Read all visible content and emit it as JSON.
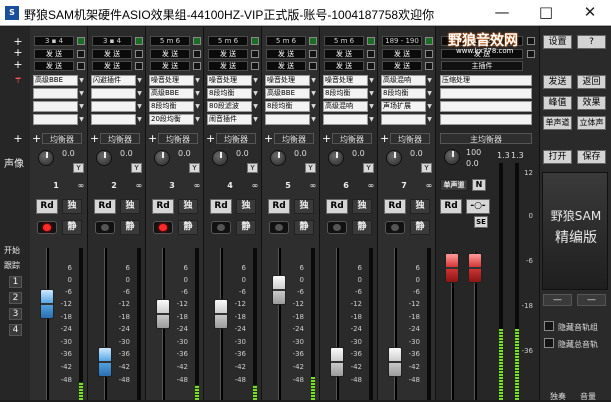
{
  "window": {
    "title": "野狼SAM机架硬件ASIO效果组-44100HZ-VIP正式版-账号-1004187758欢迎你",
    "app_icon": "S",
    "minimize": "—",
    "maximize": "□",
    "close": "✕"
  },
  "left": {
    "sym_plus": "+",
    "sym_pin": "┯",
    "sym_plus2": "+",
    "voice_label": "声像",
    "start_label": "开始",
    "follow_label": "跟踪",
    "channel_buttons": [
      "1",
      "2",
      "3",
      "4"
    ]
  },
  "channels": [
    {
      "io": "3 ▪ 4",
      "send": "发 送",
      "send2": "发 送",
      "fx": [
        "高级BBE",
        "",
        "",
        ""
      ],
      "eq": "均衡器",
      "pan": "0.0",
      "num": "1",
      "rec_on": true,
      "rec": "Rd",
      "solo": "独",
      "mute": "静"
    },
    {
      "io": "3 ▪ 4",
      "send": "发 送",
      "send2": "发 送",
      "fx": [
        "闪避插件",
        "",
        "",
        ""
      ],
      "eq": "均衡器",
      "pan": "0.0",
      "num": "2",
      "rec_on": false,
      "rec": "Rd",
      "solo": "独",
      "mute": "静"
    },
    {
      "io": "5 m 6",
      "send": "发 送",
      "send2": "发 送",
      "fx": [
        "噪音处理",
        "高级BBE",
        "8段均衡",
        "20段均衡"
      ],
      "eq": "均衡器",
      "pan": "0.0",
      "num": "3",
      "rec_on": true,
      "rec": "Rd",
      "solo": "独",
      "mute": "静"
    },
    {
      "io": "5 m 6",
      "send": "发 送",
      "send2": "发 送",
      "fx": [
        "噪音处理",
        "8段均衡",
        "80段滤波",
        "闹音插件"
      ],
      "eq": "均衡器",
      "pan": "0.0",
      "num": "4",
      "rec_on": false,
      "rec": "Rd",
      "solo": "独",
      "mute": "静"
    },
    {
      "io": "5 m 6",
      "send": "发 送",
      "send2": "发 送",
      "fx": [
        "噪音处理",
        "高级BBE",
        "8段均衡",
        ""
      ],
      "eq": "均衡器",
      "pan": "0.0",
      "num": "5",
      "rec_on": false,
      "rec": "Rd",
      "solo": "独",
      "mute": "静"
    },
    {
      "io": "5 m 6",
      "send": "发 送",
      "send2": "发 送",
      "fx": [
        "噪音处理",
        "8段均衡",
        "高级混响",
        ""
      ],
      "eq": "均衡器",
      "pan": "0.0",
      "num": "6",
      "rec_on": false,
      "rec": "Rd",
      "solo": "独",
      "mute": "静"
    },
    {
      "io": "189 - 190",
      "send": "发 送",
      "send2": "发 送",
      "fx": [
        "高级混响",
        "8段均衡",
        "声场扩展",
        ""
      ],
      "eq": "均衡器",
      "pan": "0.0",
      "num": "7",
      "rec_on": false,
      "rec": "Rd",
      "solo": "独",
      "mute": "静"
    }
  ],
  "master": {
    "io": "1 ▪ 2",
    "send": "发 送",
    "send2": "主插件",
    "fx": "压缩处理",
    "eq": "主均衡器",
    "pan_val": "100",
    "pan_val2": "0.0",
    "stereo": "单声道",
    "n": "N",
    "se": "SE",
    "rec": "Rd",
    "link": "-○-"
  },
  "scale": [
    "6",
    "0",
    "-6",
    "-12",
    "-18",
    "-24",
    "-30",
    "-36",
    "-42",
    "-48"
  ],
  "master_scale": [
    "12",
    "0",
    "-6",
    "-18",
    "-36"
  ],
  "master_meter_top": [
    "1.3",
    "1.3"
  ],
  "levels": [
    0.12,
    0.0,
    0.1,
    0.1,
    0.15,
    0.0,
    0.0
  ],
  "master_levels": [
    0.3,
    0.3
  ],
  "watermark": {
    "main": "野狼音效网",
    "sub": "www.kx778.com"
  },
  "right": {
    "settings": "设置",
    "help": "?",
    "send1": "发送",
    "return1": "返回",
    "peak": "峰值",
    "effect": "效果",
    "single": "单声道",
    "stereo": "立体声",
    "open": "打开",
    "save": "保存",
    "brand1": "野狼SAM",
    "brand2": "精编版",
    "minus1": "—",
    "minus2": "—",
    "hide_track": "隐藏音轨组",
    "hide_total": "隐藏总音轨",
    "bottom1": "独奏",
    "bottom2": "音量"
  }
}
